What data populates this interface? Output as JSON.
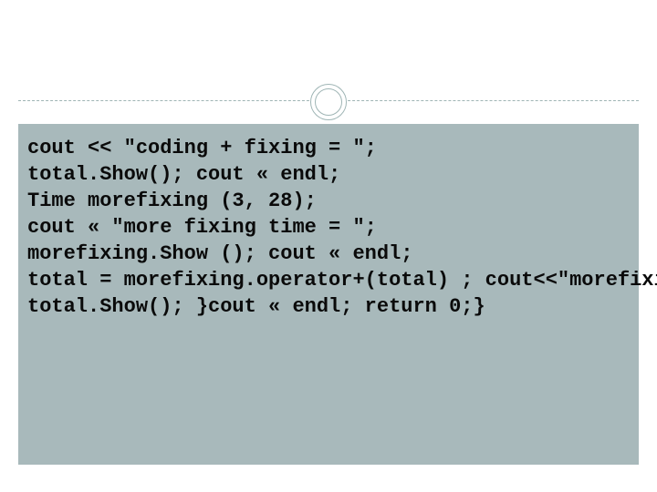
{
  "code": {
    "line1": "cout << \"coding + fixing = \";",
    "line2": "total.Show(); cout « endl;",
    "line3": "Time morefixing (3, 28);",
    "line4": "cout « \"more fixing time = \";",
    "line5": "morefixing.Show (); cout « endl;",
    "line6": "total = morefixing.operator+(total) ; cout<<\"morefixing.operator+(total)= \";",
    "line7": "total.Show(); }cout « endl; return 0;}"
  }
}
